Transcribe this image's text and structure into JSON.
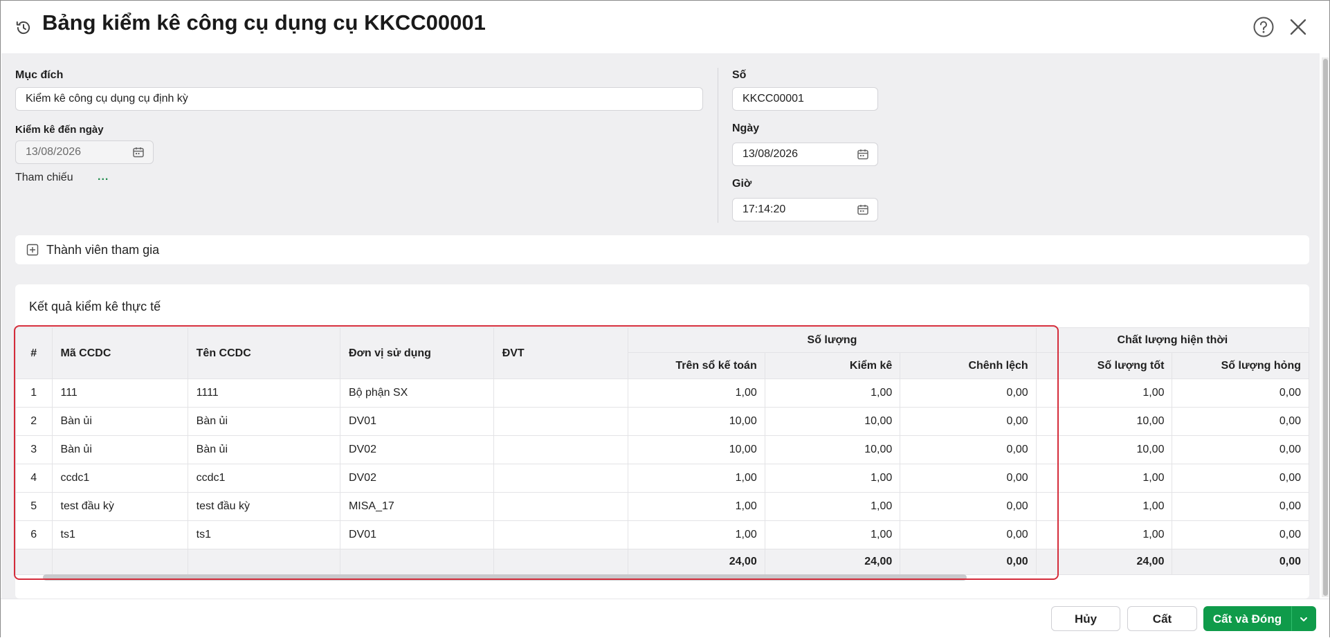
{
  "header": {
    "title": "Bảng kiểm kê công cụ dụng cụ KKCC00001",
    "icons": {
      "history": "history-icon",
      "help": "help-icon",
      "close": "close-icon"
    }
  },
  "form": {
    "purpose_label": "Mục đích",
    "purpose_value": "Kiểm kê công cụ dụng cụ định kỳ",
    "until_date_label": "Kiểm kê đến ngày",
    "until_date_value": "13/08/2026",
    "reference_label": "Tham chiếu",
    "reference_action": "...",
    "number_label": "Số",
    "number_value": "KKCC00001",
    "date_label": "Ngày",
    "date_value": "13/08/2026",
    "time_label": "Giờ",
    "time_value": "17:14:20"
  },
  "members": {
    "label": "Thành viên tham gia"
  },
  "results": {
    "title": "Kết quả kiểm kê thực tế",
    "columns": {
      "index": "#",
      "code": "Mã CCDC",
      "name": "Tên CCDC",
      "unit_use": "Đơn vị sử dụng",
      "uom": "ĐVT",
      "qty_group": "Số lượng",
      "on_books": "Trên sổ kế toán",
      "counted": "Kiểm kê",
      "difference": "Chênh lệch",
      "quality_group": "Chất lượng hiện thời",
      "good_qty": "Số lượng tốt",
      "broken_qty": "Số lượng hỏng"
    },
    "rows": [
      {
        "index": "1",
        "code": "111",
        "name": "1111",
        "unit_use": "Bộ phận SX",
        "uom": "",
        "on_books": "1,00",
        "counted": "1,00",
        "difference": "0,00",
        "good_qty": "1,00",
        "broken_qty": "0,00"
      },
      {
        "index": "2",
        "code": "Bàn ủi",
        "name": "Bàn ủi",
        "unit_use": "DV01",
        "uom": "",
        "on_books": "10,00",
        "counted": "10,00",
        "difference": "0,00",
        "good_qty": "10,00",
        "broken_qty": "0,00"
      },
      {
        "index": "3",
        "code": "Bàn ủi",
        "name": "Bàn ủi",
        "unit_use": "DV02",
        "uom": "",
        "on_books": "10,00",
        "counted": "10,00",
        "difference": "0,00",
        "good_qty": "10,00",
        "broken_qty": "0,00"
      },
      {
        "index": "4",
        "code": "ccdc1",
        "name": "ccdc1",
        "unit_use": "DV02",
        "uom": "",
        "on_books": "1,00",
        "counted": "1,00",
        "difference": "0,00",
        "good_qty": "1,00",
        "broken_qty": "0,00"
      },
      {
        "index": "5",
        "code": "test đầu kỳ",
        "name": "test đầu kỳ",
        "unit_use": "MISA_17",
        "uom": "",
        "on_books": "1,00",
        "counted": "1,00",
        "difference": "0,00",
        "good_qty": "1,00",
        "broken_qty": "0,00"
      },
      {
        "index": "6",
        "code": "ts1",
        "name": "ts1",
        "unit_use": "DV01",
        "uom": "",
        "on_books": "1,00",
        "counted": "1,00",
        "difference": "0,00",
        "good_qty": "1,00",
        "broken_qty": "0,00"
      }
    ],
    "totals": {
      "on_books": "24,00",
      "counted": "24,00",
      "difference": "0,00",
      "good_qty": "24,00",
      "broken_qty": "0,00"
    }
  },
  "footer": {
    "cancel": "Hủy",
    "save": "Cất",
    "save_close": "Cất và Đóng"
  },
  "colors": {
    "accent": "#0f9b4a",
    "highlight": "#d42c3a",
    "link": "#1f8a4c"
  }
}
